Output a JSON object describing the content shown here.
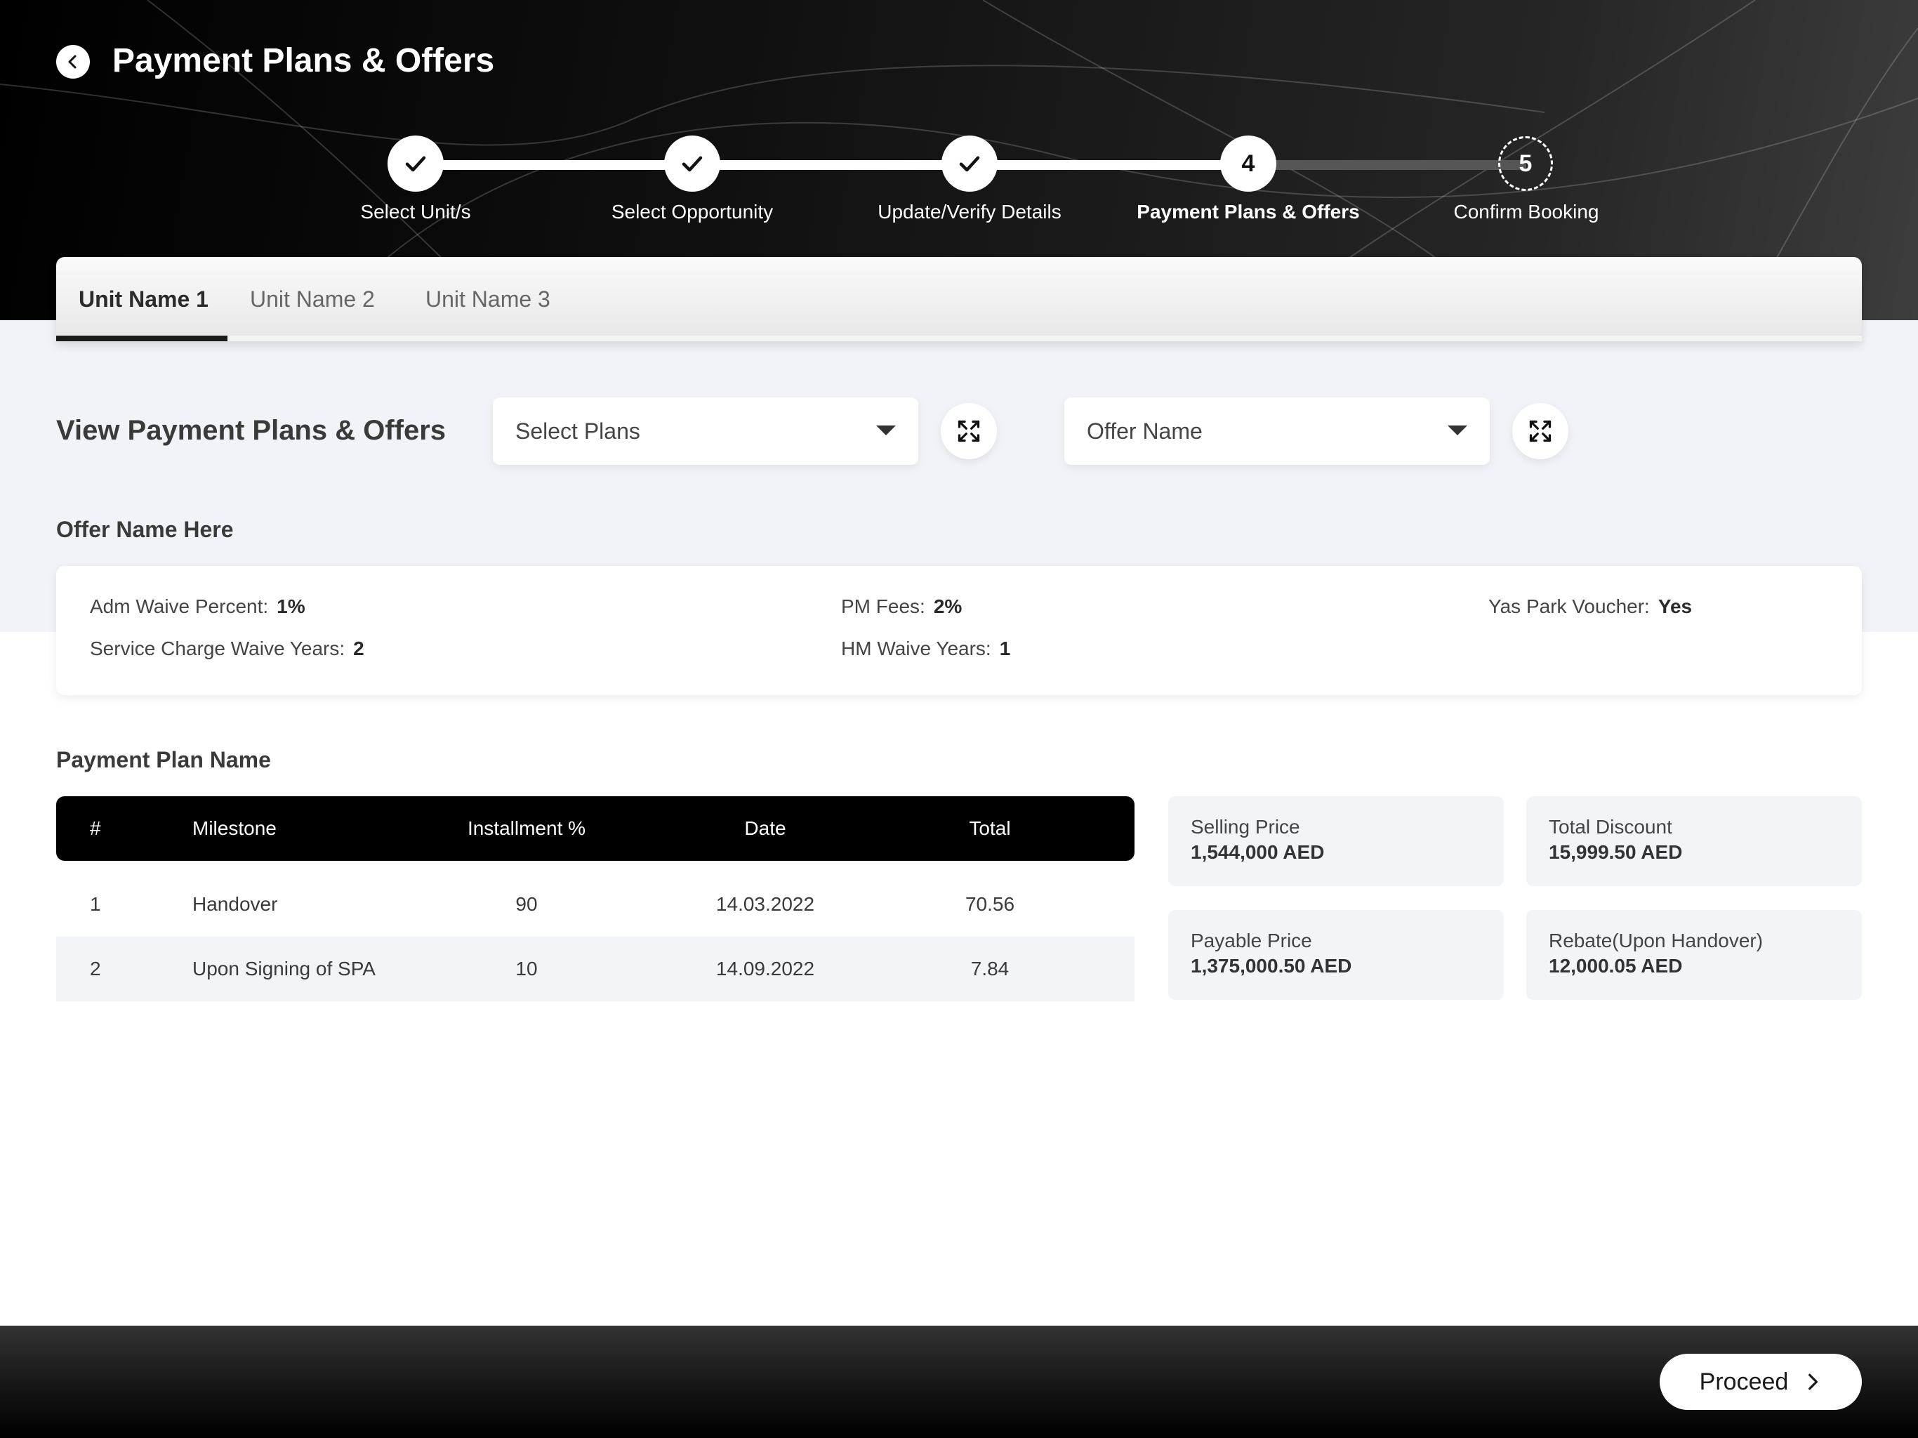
{
  "header": {
    "title": "Payment Plans & Offers",
    "back_icon": "chevron-left-icon"
  },
  "stepper": {
    "steps": [
      {
        "label": "Select Unit/s",
        "status": "completed",
        "marker": ""
      },
      {
        "label": "Select Opportunity",
        "status": "completed",
        "marker": ""
      },
      {
        "label": "Update/Verify Details",
        "status": "completed",
        "marker": ""
      },
      {
        "label": "Payment Plans & Offers",
        "status": "current",
        "marker": "4"
      },
      {
        "label": "Confirm Booking",
        "status": "pending",
        "marker": "5"
      }
    ]
  },
  "tabs": [
    {
      "label": "Unit Name 1",
      "active": true
    },
    {
      "label": "Unit Name 2",
      "active": false
    },
    {
      "label": "Unit Name 3",
      "active": false
    }
  ],
  "plans": {
    "title": "View Payment Plans & Offers",
    "select_plans": "Select Plans",
    "offer_name": "Offer Name",
    "expand_icon": "expand-icon"
  },
  "offer": {
    "title": "Offer Name Here",
    "items": [
      {
        "label": "Adm Waive Percent:",
        "value": "1%"
      },
      {
        "label": "PM Fees:",
        "value": "2%"
      },
      {
        "label": "Yas Park Voucher:",
        "value": "Yes"
      },
      {
        "label": "Service Charge Waive Years:",
        "value": "2"
      },
      {
        "label": "HM Waive Years:",
        "value": "1"
      }
    ]
  },
  "payment_plan": {
    "title": "Payment Plan Name",
    "columns": [
      "#",
      "Milestone",
      "Installment %",
      "Date",
      "Total"
    ],
    "rows": [
      [
        "1",
        "Handover",
        "90",
        "14.03.2022",
        "70.56"
      ],
      [
        "2",
        "Upon Signing of SPA",
        "10",
        "14.09.2022",
        "7.84"
      ]
    ]
  },
  "pricing": {
    "selling_price_label": "Selling Price",
    "selling_price_value": "1,544,000 AED",
    "total_discount_label": "Total Discount",
    "total_discount_value": "15,999.50 AED",
    "payable_price_label": "Payable Price",
    "payable_price_value": "1,375,000.50 AED",
    "rebate_label": "Rebate(Upon Handover)",
    "rebate_value": "12,000.05 AED"
  },
  "footer": {
    "proceed_label": "Proceed"
  },
  "colors": {
    "header_bg": "#000000",
    "band_bg": "#f1f3f8",
    "accent": "#ffffff",
    "table_header": "#000000"
  }
}
